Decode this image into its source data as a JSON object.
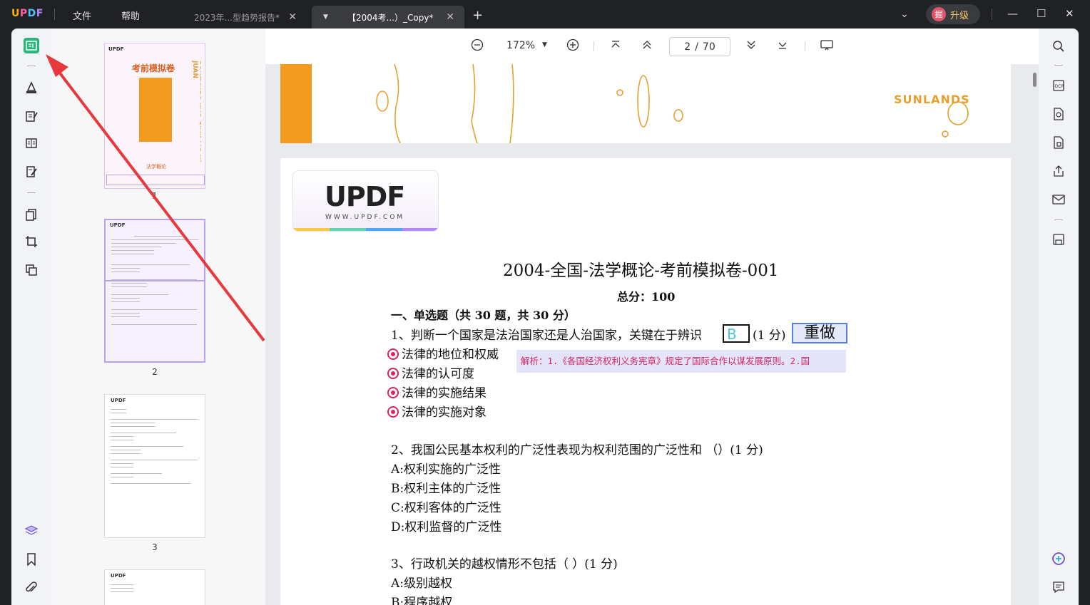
{
  "app": {
    "logo": "UPDF"
  },
  "menu": {
    "file": "文件",
    "help": "帮助"
  },
  "tabs": [
    {
      "title": "2023年...型趋势报告*",
      "active": false
    },
    {
      "title": "【2004考...）_Copy*",
      "active": true
    }
  ],
  "account": {
    "avatar_text": "掘",
    "upgrade_label": "升级"
  },
  "toolbar": {
    "zoom": "172%",
    "current_page": "2",
    "page_sep": "/",
    "total_pages": "70"
  },
  "thumbnails": [
    {
      "number": "1",
      "title": "考前模拟卷",
      "side_text": "SUNLANDS KAO QIAN MO NI JUAN",
      "subtitle": "法学概论"
    },
    {
      "number": "2"
    },
    {
      "number": "3"
    }
  ],
  "page1": {
    "brand": "SUNLANDS"
  },
  "document": {
    "logo_text": "UPDF",
    "logo_url": "WWW.UPDF.COM",
    "title": "2004-全国-法学概论-考前模拟卷-001",
    "total_score": "总分：100",
    "section1": "一、单选题（共 30 题，共 30 分）",
    "q1": {
      "text": "1、判断一个国家是法治国家还是人治国家，关键在于辨识",
      "answer": "B",
      "points": "(1 分)",
      "redo": "重做",
      "options": [
        "法律的地位和权威",
        "法律的认可度",
        "法律的实施结果",
        "法律的实施对象"
      ],
      "analysis": "解析：1.《各国经济权利义务宪章》规定了国际合作以谋发展原则。2.国"
    },
    "q2": {
      "text": "2、我国公民基本权利的广泛性表现为权利范围的广泛性和 （）(1 分)",
      "options": [
        "A:权利实施的广泛性",
        "B:权利主体的广泛性",
        "C:权利客体的广泛性",
        "D:权利监督的广泛性"
      ]
    },
    "q3": {
      "text": "3、行政机关的越权情形不包括（ ）(1 分)",
      "options": [
        "A:级别越权",
        "B:程序越权"
      ]
    }
  },
  "colors": {
    "accent": "#2ab57d",
    "annotation": "#d8255f",
    "arrow": "#e8383d"
  }
}
